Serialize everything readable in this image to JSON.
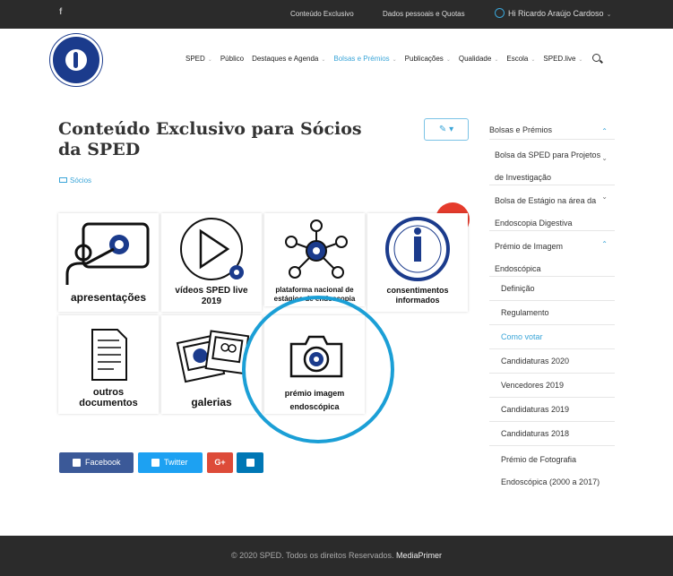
{
  "topbar": {
    "social": "f",
    "link1": "Conteúdo Exclusivo",
    "link2": "Dados pessoais e Quotas",
    "user": "Hi Ricardo Araújo Cardoso",
    "caret": "⌄"
  },
  "nav": {
    "items": [
      {
        "label": "SPED",
        "caret": true
      },
      {
        "label": "Público",
        "caret": false
      },
      {
        "label": "Destaques e Agenda",
        "caret": true
      },
      {
        "label": "Bolsas e Prémios",
        "caret": true,
        "active": true
      },
      {
        "label": "Publicações",
        "caret": true
      },
      {
        "label": "Qualidade",
        "caret": true
      },
      {
        "label": "Escola",
        "caret": true
      },
      {
        "label": "SPED.live",
        "caret": true
      }
    ],
    "caret_glyph": "⌄"
  },
  "main": {
    "title": "Conteúdo Exclusivo para Sócios da SPED",
    "edit_icon": "✎ ▾",
    "breadcrumb": "Sócios"
  },
  "tiles": {
    "apresentacoes": "apresentações",
    "videos_line1": "vídeos SPED live",
    "videos_line2": "2019",
    "plataforma_line1": "plataforma nacional de",
    "plataforma_line2": "estágios de endoscopia",
    "consent_line1": "consentimentos",
    "consent_line2": "informados",
    "outros_line1": "outros",
    "outros_line2": "documentos",
    "galerias": "galerias",
    "premio_line1": "prémio imagem",
    "premio_line2": "endoscópica"
  },
  "share": {
    "facebook": "Facebook",
    "twitter": "Twitter",
    "gplus": "G+"
  },
  "sidebar": {
    "heading": "Bolsas e Prémios",
    "items": [
      {
        "label": "Bolsa da SPED para Projetos"
      },
      {
        "label": "de Investigação"
      },
      {
        "label": "Bolsa de Estágio na área da"
      },
      {
        "label": "Endoscopia Digestiva"
      },
      {
        "label": "Prémio de Imagem"
      },
      {
        "label": "Endoscópica"
      },
      {
        "label": "Definição"
      },
      {
        "label": "Regulamento"
      },
      {
        "label": "Como votar"
      },
      {
        "label": "Candidaturas 2020"
      },
      {
        "label": "Vencedores 2019"
      },
      {
        "label": "Candidaturas 2019"
      },
      {
        "label": "Candidaturas 2018"
      },
      {
        "label": "Prémio de Fotografia"
      },
      {
        "label": "Endoscópica (2000 a 2017)"
      }
    ],
    "arrow_up": "⌃",
    "arrow_down": "⌄"
  },
  "footer": {
    "text": "© 2020 SPED. Todos os direitos Reservados.",
    "brand": "MediaPrimer"
  },
  "colors": {
    "accent": "#3aa5d8",
    "topbar": "#2b2b2b",
    "highlight": "#1b9fd6"
  }
}
